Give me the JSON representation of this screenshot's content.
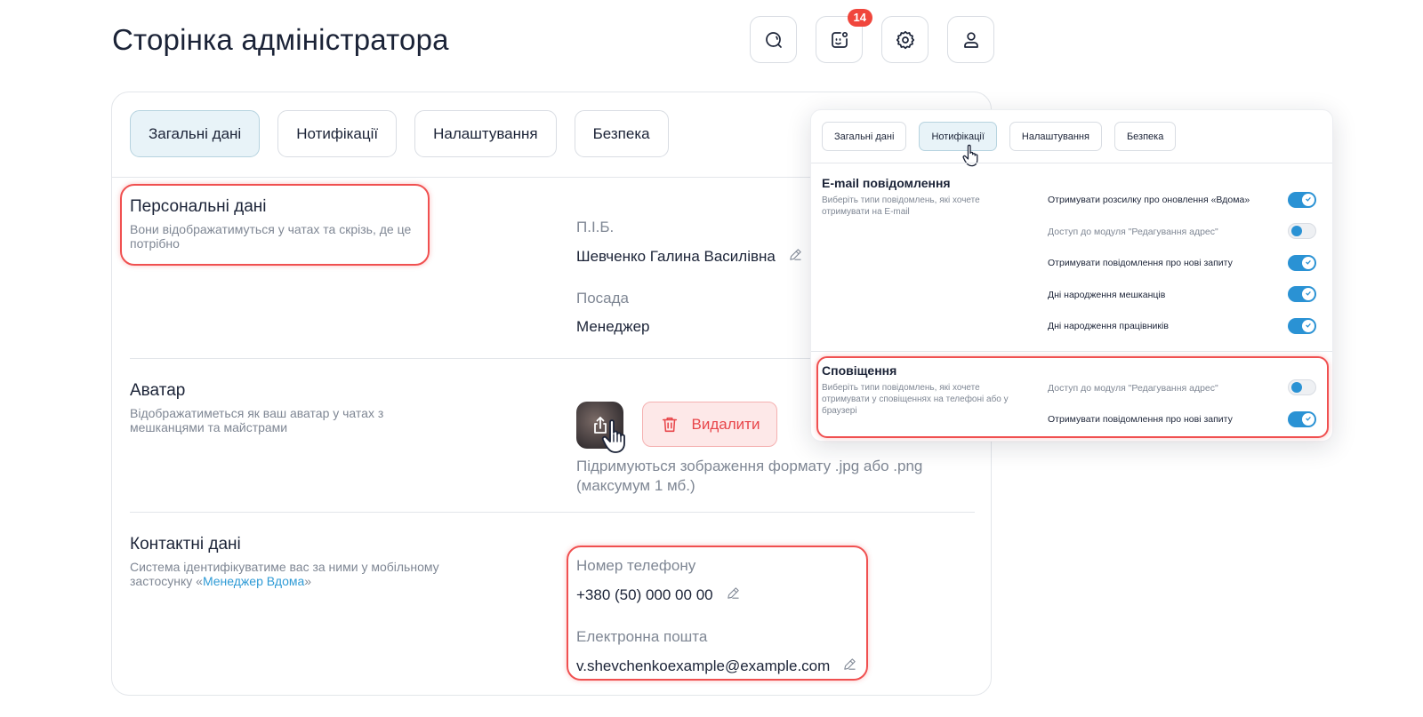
{
  "page_title": "Сторінка адміністратора",
  "header": {
    "notifications_badge": "14",
    "icons": [
      "search-icon",
      "notifications-icon",
      "gear-icon",
      "user-icon"
    ]
  },
  "tabs": [
    "Загальні дані",
    "Нотифікації",
    "Налаштування",
    "Безпека"
  ],
  "personal": {
    "title": "Персональні дані",
    "desc": "Вони відображатимуться у чатах та скрізь, де це потрібно",
    "name_label": "П.І.Б.",
    "name_value": "Шевченко Галина Василівна",
    "position_label": "Посада",
    "position_value": "Менеджер"
  },
  "avatar": {
    "title": "Аватар",
    "desc": "Відображатиметься як ваш аватар у чатах з мешканцями та майстрами",
    "delete_label": "Видалити",
    "hint": "Підримуються зображення формату .jpg або .png (максумум 1 мб.)"
  },
  "contacts": {
    "title": "Контактні дані",
    "desc_prefix": "Система ідентифікуватиме вас за ними у мобільному застосунку «",
    "desc_link": "Менеджер Вдома",
    "desc_suffix": "»",
    "phone_label": "Номер телефону",
    "phone_value": "+380 (50) 000 00 00",
    "email_label": "Електронна пошта",
    "email_value": "v.shevchenkoexample@example.com"
  },
  "popup": {
    "tabs": [
      "Загальні дані",
      "Нотифікації",
      "Налаштування",
      "Безпека"
    ],
    "email_section": {
      "title": "E-mail повідомлення",
      "desc": "Виберіть типи повідомлень, які хочете отримувати на E-mail",
      "rows": [
        {
          "label": "Отримувати розсилку про оновлення «Вдома»",
          "on": true
        },
        {
          "label": "Доступ до модуля \"Редагування адрес\"",
          "on": false
        },
        {
          "label": "Отримувати повідомлення про нові запиту",
          "on": true
        },
        {
          "label": "Дні народження мешканців",
          "on": true
        },
        {
          "label": "Дні народження працівників",
          "on": true
        }
      ]
    },
    "alerts_section": {
      "title": "Сповіщення",
      "desc": "Виберіть типи повідомлень, які хочете отримувати у сповіщеннях на телефоні або у браузері",
      "rows": [
        {
          "label": "Доступ до модуля \"Редагування адрес\"",
          "on": false
        },
        {
          "label": "Отримувати повідомлення про нові запиту",
          "on": true
        }
      ]
    }
  },
  "colors": {
    "accent": "#2a92d4",
    "danger": "#e8464a",
    "highlight": "#f05050",
    "active_tab_bg": "#e8f3f8"
  }
}
